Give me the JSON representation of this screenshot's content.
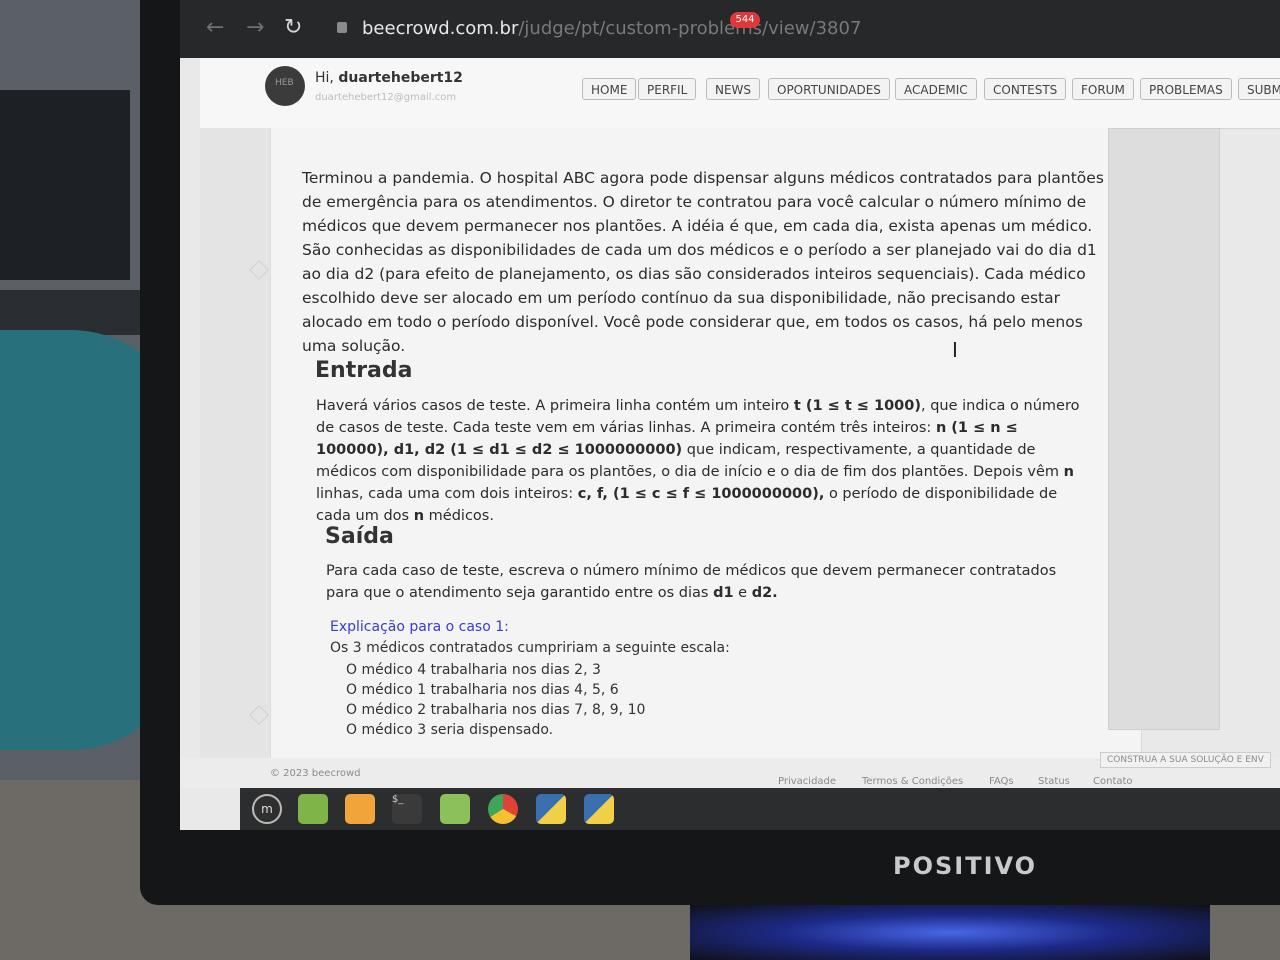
{
  "browser": {
    "url_host": "beecrowd.com.br",
    "url_path": "/judge/pt/custom-problems/view/3807"
  },
  "user": {
    "greeting": "Hi,",
    "name": "duartehebert12",
    "email": "duartehebert12@gmail.com"
  },
  "nav": {
    "items": [
      "HOME",
      "PERFIL",
      "NEWS",
      "OPORTUNIDADES",
      "ACADEMIC",
      "CONTESTS",
      "FORUM",
      "PROBLEMAS",
      "SUBM"
    ],
    "news_badge": "544"
  },
  "problem": {
    "intro": "Terminou a pandemia. O hospital ABC agora pode dispensar alguns médicos contratados para plantões de emergência para os atendimentos. O diretor te contratou para você calcular o número mínimo de médicos que devem permanecer nos plantões. A idéia é que, em cada dia, exista apenas um médico. São conhecidas as disponibilidades de cada um dos médicos e o período a ser planejado vai do dia d1 ao dia d2 (para efeito de planejamento, os dias são considerados inteiros sequenciais). Cada médico escolhido deve ser alocado em um período contínuo da sua disponibilidade, não precisando estar alocado em todo o período disponível. Você pode considerar que, em todos os casos, há pelo menos uma solução.",
    "entrada_title": "Entrada",
    "entrada": {
      "t1": "Haverá vários casos de teste. A primeira linha contém um inteiro ",
      "b1": "t (1 ≤ t ≤ 1000)",
      "t2": ", que indica o número de casos de teste. Cada teste vem em várias linhas. A primeira contém três inteiros: ",
      "b2": "n (1 ≤ n ≤ 100000), d1, d2 (1 ≤ d1 ≤ d2 ≤ 1000000000)",
      "t3": " que indicam, respectivamente, a quantidade de médicos com disponibilidade para os plantões, o dia de início e o dia de fim dos plantões. Depois vêm ",
      "b3": "n",
      "t4": " linhas, cada uma com dois inteiros: ",
      "b4": "c, f,  (1 ≤ c ≤ f ≤ 1000000000),",
      "t5": " o período de disponibilidade de cada um dos ",
      "b5": "n",
      "t6": " médicos."
    },
    "saida_title": "Saída",
    "saida": {
      "t1": "Para cada caso de teste, escreva o número mínimo de médicos que devem permanecer contratados para que o atendimento seja garantido entre os dias ",
      "b1": "d1",
      "t2": " e ",
      "b2": "d2.",
      "t3": ""
    },
    "explicacao_title": "Explicação para o caso 1:",
    "explicacao_intro": "Os 3 médicos contratados cumpririam a seguinte escala:",
    "explicacao_items": [
      "O médico 4 trabalharia nos dias 2, 3",
      "O médico 1 trabalharia nos dias 4, 5, 6",
      "O médico 2 trabalharia nos dias 7, 8, 9, 10",
      "O médico 3 seria dispensado."
    ]
  },
  "footer": {
    "copyright": "© 2023 beecrowd",
    "links": [
      "Privacidade",
      "Termos & Condições",
      "FAQs",
      "Status",
      "Contato"
    ],
    "build_button": "CONSTRUA A SUA SOLUÇÃO E ENV"
  },
  "monitor": {
    "brand": "POSITIVO"
  }
}
